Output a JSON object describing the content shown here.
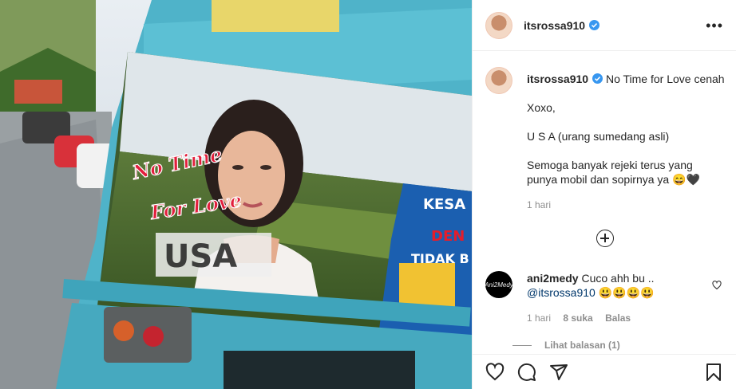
{
  "post": {
    "username": "itsrossa910",
    "more_label": "•••"
  },
  "caption": {
    "username": "itsrossa910",
    "first_line": "No Time for Love cenah",
    "lines": [
      "Xoxo,",
      "U S A (urang sumedang asli)",
      "Semoga banyak rejeki terus yang punya mobil dan sopirnya ya 😄🖤"
    ],
    "time": "1 hari"
  },
  "comment": {
    "username": "ani2medy",
    "text": "Cuco ahh bu ..",
    "mention": "@itsrossa910",
    "emojis": "😃😃😃😃",
    "avatar_text": "Ani2Medy",
    "time": "1 hari",
    "likes": "8 suka",
    "reply_label": "Balas",
    "view_replies": "Lihat balasan (1)"
  },
  "photo": {
    "sign_text": [
      "No Time",
      "For Love"
    ],
    "truck_text": [
      "KESA",
      "DEN",
      "TIDAK B"
    ]
  },
  "colors": {
    "truck": "#4fb3c9",
    "verified": "#3897f0",
    "link": "#00376b"
  },
  "icons": [
    "verified-badge-icon",
    "more-options-icon",
    "add-comment-icon",
    "heart-icon",
    "comment-icon",
    "share-icon",
    "bookmark-icon"
  ]
}
